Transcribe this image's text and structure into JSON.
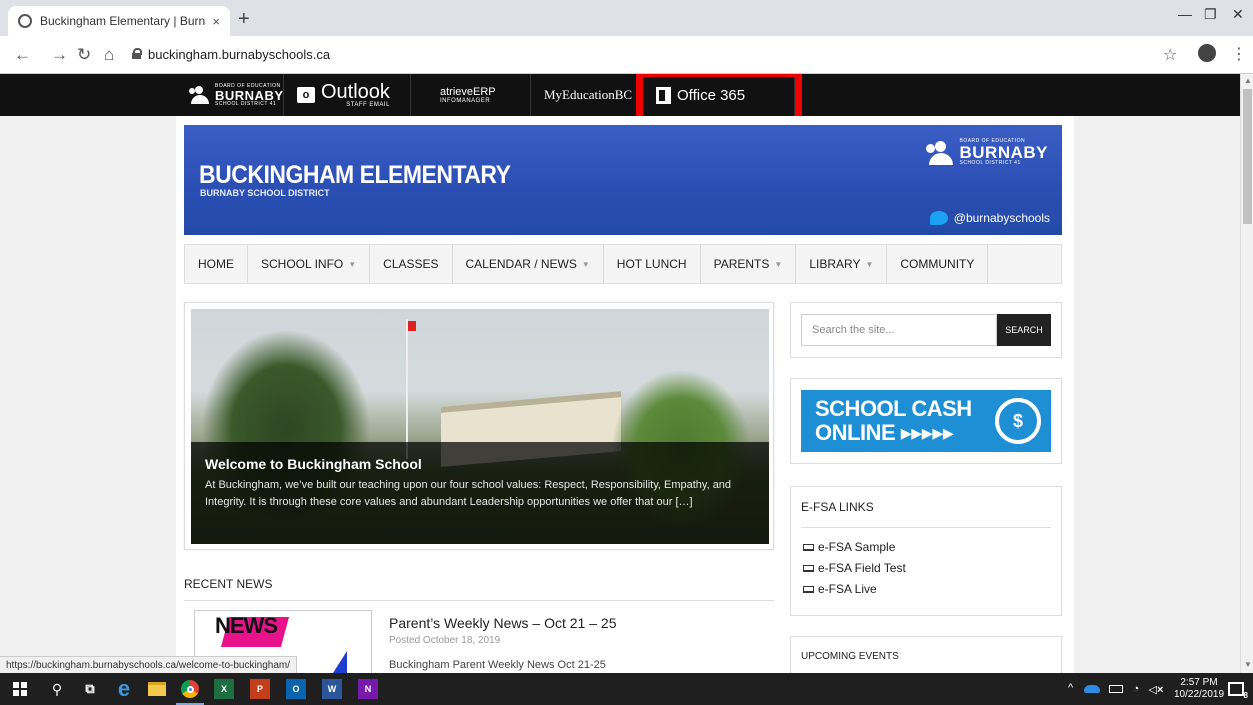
{
  "browser": {
    "tab_title": "Buckingham Elementary | Burnaby",
    "tab_close": "×",
    "new_tab": "+",
    "url": "buckingham.burnabyschools.ca",
    "status_url": "https://buckingham.burnabyschools.ca/welcome-to-buckingham/"
  },
  "topbar": {
    "burnaby_small": "BOARD OF EDUCATION",
    "burnaby_big": "BURNABY",
    "burnaby_district": "SCHOOL DISTRICT 41",
    "outlook": "Outlook",
    "outlook_sub": "STAFF EMAIL",
    "atrieve": "atrieveERP",
    "atrieve_sub": "INFOMANAGER",
    "myedu": "MyEducationBC",
    "office365": "Office 365"
  },
  "banner": {
    "title": "BUCKINGHAM ELEMENTARY",
    "subtitle": "BURNABY SCHOOL DISTRICT",
    "twitter": "@burnabyschools"
  },
  "nav": [
    {
      "label": "HOME",
      "caret": false
    },
    {
      "label": "SCHOOL INFO",
      "caret": true
    },
    {
      "label": "CLASSES",
      "caret": false
    },
    {
      "label": "CALENDAR / NEWS",
      "caret": true
    },
    {
      "label": "HOT LUNCH",
      "caret": false
    },
    {
      "label": "PARENTS",
      "caret": true
    },
    {
      "label": "LIBRARY",
      "caret": true
    },
    {
      "label": "COMMUNITY",
      "caret": false
    }
  ],
  "feature": {
    "title": "Welcome to Buckingham School",
    "text": "At Buckingham, we’ve built our teaching upon our four school values: Respect, Responsibility, Empathy, and Integrity.  It is through these core values and abundant Leadership opportunities we offer that our […]"
  },
  "recent_news": {
    "heading": "RECENT NEWS",
    "thumb_text": "NEWS",
    "items": [
      {
        "title": "Parent’s Weekly News – Oct 21 – 25",
        "date": "Posted October 18, 2019",
        "excerpt": "Buckingham Parent Weekly News Oct 21-25"
      }
    ]
  },
  "sidebar": {
    "search_placeholder": "Search the site...",
    "search_button": "SEARCH",
    "cash_line1": "SCHOOL CASH",
    "cash_line2": "ONLINE ▸▸▸▸▸",
    "cash_icon": "$",
    "efsa_heading": "E-FSA LINKS",
    "efsa_links": [
      "e-FSA Sample",
      "e-FSA Field Test",
      "e-FSA Live"
    ],
    "upcoming_heading": "UPCOMING EVENTS"
  },
  "taskbar": {
    "time": "2:57 PM",
    "date": "10/22/2019",
    "notification_count": "8"
  },
  "colors": {
    "banner_blue": "#2a4eb3",
    "highlight_red": "#ee0000",
    "cash_blue": "#1e8fd5"
  }
}
